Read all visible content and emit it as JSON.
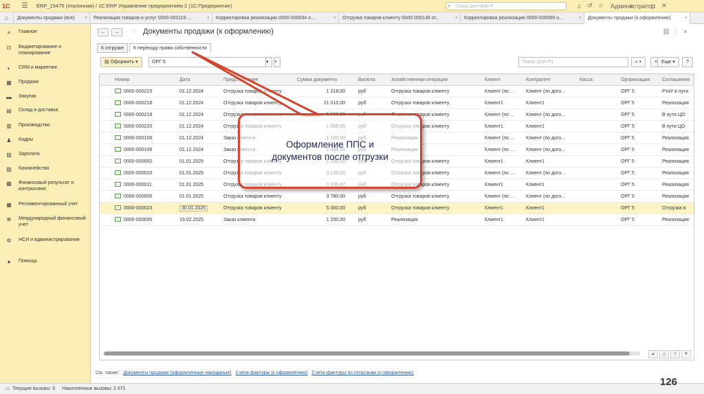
{
  "titlebar": {
    "logo": "1С",
    "title": "ERP_15470 (эталонная) / 1С:ERP Управление предприятием 2  (1С:Предприятие)",
    "search_placeholder": "Поиск Ctrl+Shift+F",
    "user": "Администратор"
  },
  "tabs": [
    "Документы продажи (все)",
    "Реализация товаров и услуг 0000-000119 ...",
    "Корректировка реализации 0000-000034 о...",
    "Отгрузка товаров клиенту 0000-000138 от...",
    "Корректировка реализации 0000-000069 о...",
    "Документы продажи (к оформлению)"
  ],
  "sidebar": {
    "items": [
      {
        "icon": "≡",
        "label": "Главное"
      },
      {
        "icon": "⊡",
        "label": "Бюджетирование и планирование"
      },
      {
        "icon": "◐",
        "label": "CRM и маркетинг"
      },
      {
        "icon": "▦",
        "label": "Продажи"
      },
      {
        "icon": "▬",
        "label": "Закупки"
      },
      {
        "icon": "▤",
        "label": "Склад и доставка"
      },
      {
        "icon": "▥",
        "label": "Производство"
      },
      {
        "icon": "♟",
        "label": "Кадры"
      },
      {
        "icon": "▧",
        "label": "Зарплата"
      },
      {
        "icon": "▨",
        "label": "Казначейство"
      },
      {
        "icon": "▩",
        "label": "Финансовый результат и контроллинг"
      },
      {
        "icon": "▦",
        "label": "Регламентированный учет"
      },
      {
        "icon": "⊕",
        "label": "Международный финансовый учет"
      },
      {
        "icon": "⚙",
        "label": "НСИ и администрирование"
      },
      {
        "icon": "●",
        "label": "Помощь"
      }
    ]
  },
  "page": {
    "title": "Документы продажи (к оформлению)",
    "subtabs": [
      "К отгрузке",
      "К переходу права собственности"
    ]
  },
  "toolbar": {
    "oformit": "Оформить",
    "org_value": "ОРГ 5",
    "search_placeholder": "Поиск (Ctrl+F)",
    "more": "Еще",
    "help": "?"
  },
  "table": {
    "columns": [
      "Номер",
      "Дата",
      "Представление",
      "Сумма документа",
      "Валюта",
      "Хозяйственная операция",
      "Клиент",
      "Контрагент",
      "Касса",
      "Организация",
      "Соглашение"
    ],
    "rows": [
      [
        "0000-000215",
        "01.12.2024",
        "Отгрузка товаров клиенту",
        "1 218,00",
        "руб",
        "Отгрузка товаров клиенту",
        "Клиент (по ...",
        "Клиент (по дого...",
        "",
        "ОРГ 5",
        "РтиУ в пути"
      ],
      [
        "0000-000218",
        "01.12.2024",
        "Отгрузка товаров клиенту",
        "21 010,00",
        "руб",
        "Отгрузка товаров клиенту",
        "Клиент1",
        "Клиент1",
        "",
        "ОРГ 5",
        "Реализация"
      ],
      [
        "0000-000219",
        "01.12.2024",
        "Отгрузка товаров клиенту",
        "5 000,00",
        "руб",
        "Отгрузка товаров клиенту",
        "Клиент (по ...",
        "Клиент (по дого...",
        "",
        "ОРГ 5",
        "В пути ЦО"
      ],
      [
        "0000-000220",
        "01.12.2024",
        "Отгрузка товаров клиенту",
        "1 066,65",
        "руб",
        "Отгрузка товаров клиенту",
        "Клиент1",
        "Клиент1",
        "",
        "ОРГ 5",
        "В пути ЦО"
      ],
      [
        "0000-000108",
        "01.12.2024",
        "Заказ клиента",
        "1 100,00",
        "руб",
        "Реализация",
        "Клиент (по ...",
        "Клиент (по дого...",
        "",
        "ОРГ 5",
        "Реализация"
      ],
      [
        "0000-000109",
        "01.12.2024",
        "Заказ клиента",
        "2 436,00",
        "руб",
        "Реализация",
        "Клиент (по ...",
        "Клиент (по дого...",
        "",
        "ОРГ 5",
        "Реализация"
      ],
      [
        "0000-000002",
        "01.01.2025",
        "Отгрузка товаров клиенту",
        "1 200,00",
        "руб",
        "Отгрузка товаров клиенту",
        "Клиент1",
        "Клиент1",
        "",
        "ОРГ 5",
        "Реализация"
      ],
      [
        "0000-000010",
        "01.01.2025",
        "Отгрузка товаров клиенту",
        "3 100,00",
        "руб",
        "Отгрузка товаров клиенту",
        "Клиент (по ...",
        "Клиент (по дого...",
        "",
        "ОРГ 5",
        "Реализация"
      ],
      [
        "0000-000011",
        "01.01.2025",
        "Отгрузка товаров клиенту",
        "3 136,67",
        "руб",
        "Отгрузка товаров клиенту",
        "Клиент1",
        "Клиент1",
        "",
        "ОРГ 5",
        "Реализация"
      ],
      [
        "0000-000006",
        "01.01.2025",
        "Отгрузка товаров клиенту",
        "3 780,00",
        "руб",
        "Отгрузка товаров клиенту",
        "Клиент (по ...",
        "Клиент (по дого...",
        "",
        "ОРГ 5",
        "Реализация"
      ],
      [
        "0000-000023",
        "30.01.2025",
        "Отгрузка товаров клиенту",
        "5 000,00",
        "руб",
        "Отгрузка товаров клиенту",
        "Клиент1",
        "Клиент1",
        "",
        "ОРГ 5",
        "Отгрузка в"
      ],
      [
        "0000-000035",
        "19.02.2025",
        "Заказ клиента",
        "1 200,00",
        "руб",
        "Реализация",
        "Клиент1",
        "Клиент1",
        "",
        "ОРГ 5",
        "Реализация"
      ]
    ],
    "selected_row": 10
  },
  "see_also": {
    "label": "См. также:",
    "links": [
      "Документы продажи (оформленные накладные)",
      "Счета-фактуры (к оформлению)",
      "Счета-фактуры по отгрузкам (к оформлению)"
    ]
  },
  "statusbar": {
    "current_calls": "Текущие вызовы: 0",
    "accum_calls": "Накопленные вызовы: 2 671"
  },
  "callout": {
    "line1": "Оформление ППС и",
    "line2": "документов после отгрузки"
  },
  "slide_number": "126",
  "colors": {
    "sidebar_bg": "#fbeeb6",
    "callout_border": "#d2452e",
    "selected_row": "#fdf3c4",
    "link": "#2a5a9a"
  }
}
